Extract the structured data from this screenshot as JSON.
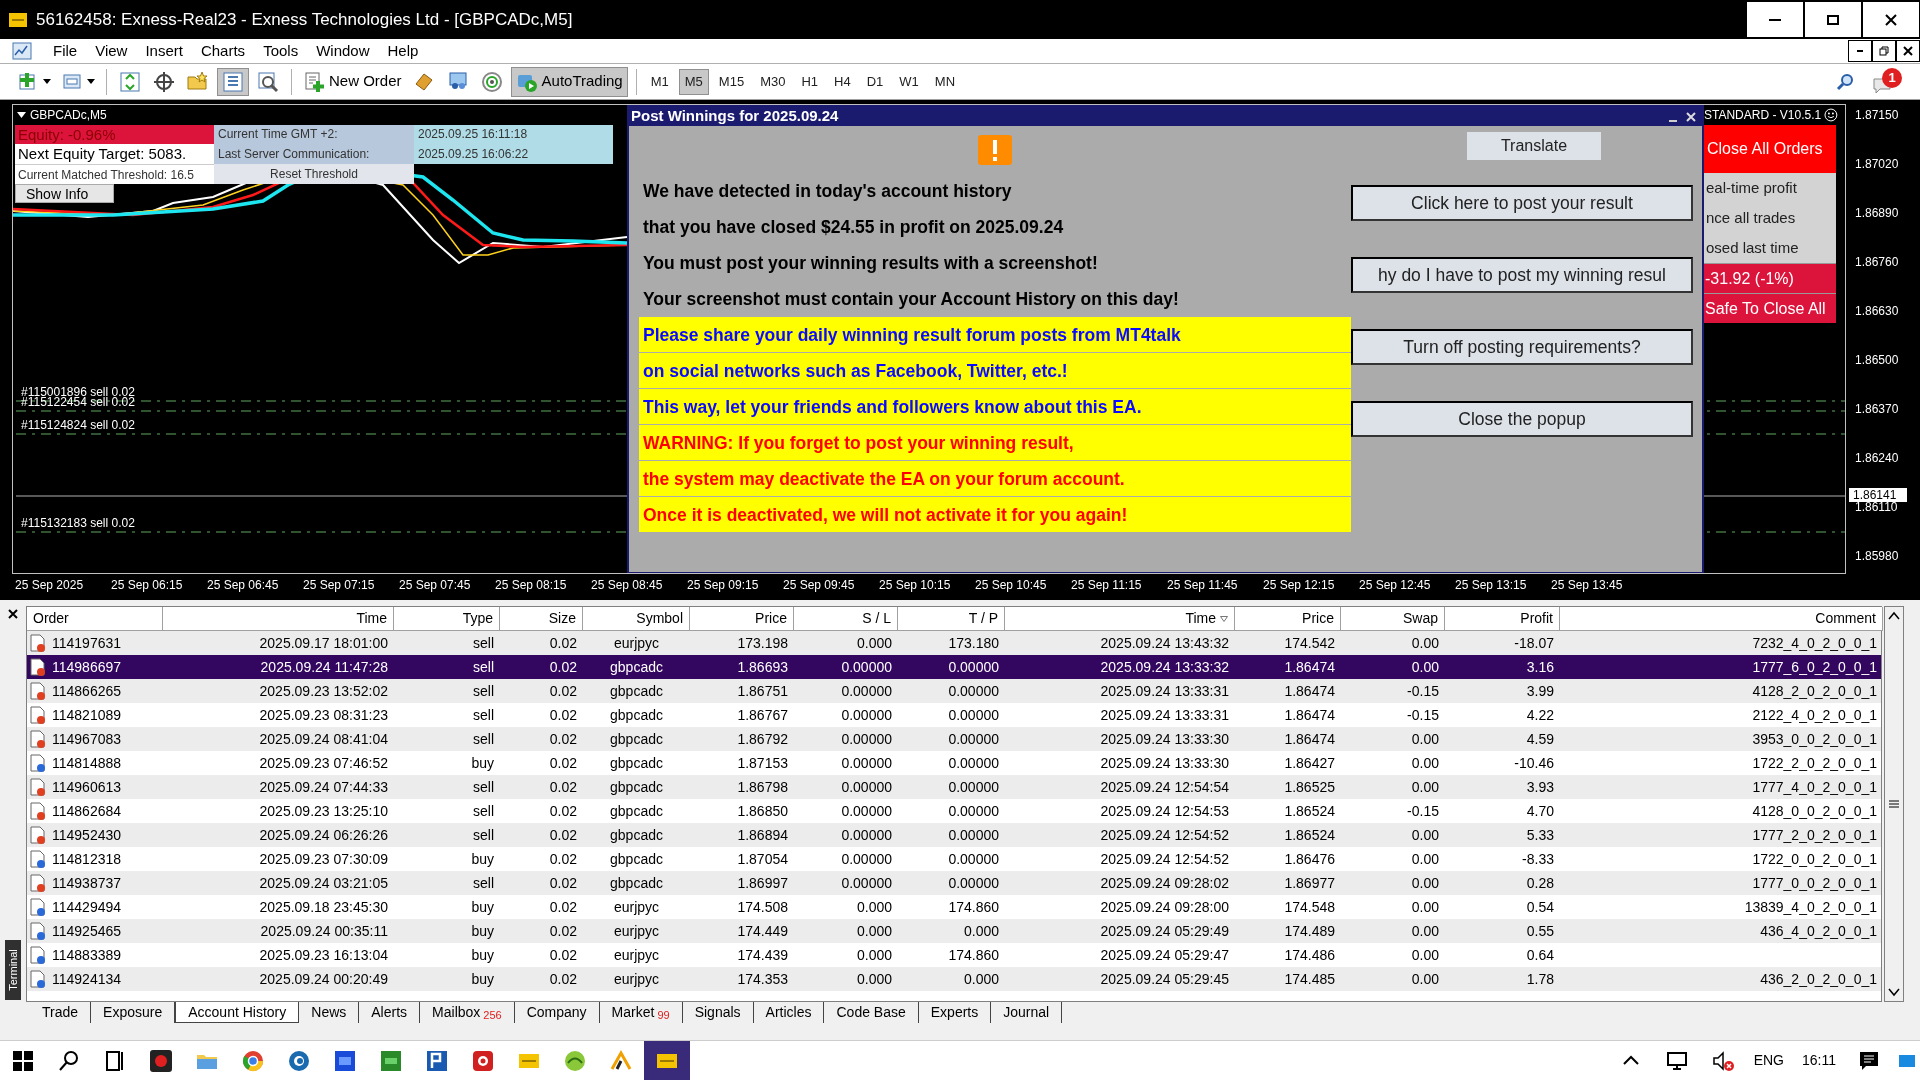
{
  "window": {
    "title": "56162458: Exness-Real23 - Exness Technologies Ltd - [GBPCADc,M5]"
  },
  "menu": [
    "File",
    "View",
    "Insert",
    "Charts",
    "Tools",
    "Window",
    "Help"
  ],
  "toolbar": {
    "new_order": "New Order",
    "autotrading": {
      "label": "AutoTrading",
      "pressed": true
    },
    "timeframes": [
      {
        "label": "M1",
        "selected": false
      },
      {
        "label": "M5",
        "selected": true
      },
      {
        "label": "M15",
        "selected": false
      },
      {
        "label": "M30",
        "selected": false
      },
      {
        "label": "H1",
        "selected": false
      },
      {
        "label": "H4",
        "selected": false
      },
      {
        "label": "D1",
        "selected": false
      },
      {
        "label": "W1",
        "selected": false
      },
      {
        "label": "MN",
        "selected": false
      }
    ],
    "notification_count": "1"
  },
  "chart": {
    "symbol": "GBPCADc,M5",
    "price_labels": [
      "1.87150",
      "1.87020",
      "1.86890",
      "1.86760",
      "1.86630",
      "1.86500",
      "1.86370",
      "1.86240",
      "1.86110",
      "1.85980"
    ],
    "current_price": "1.86141",
    "time_labels": [
      "25 Sep 2025",
      "25 Sep 06:15",
      "25 Sep 06:45",
      "25 Sep 07:15",
      "25 Sep 07:45",
      "25 Sep 08:15",
      "25 Sep 08:45",
      "25 Sep 09:15",
      "25 Sep 09:45",
      "25 Sep 10:15",
      "25 Sep 10:45",
      "25 Sep 11:15",
      "25 Sep 11:45",
      "25 Sep 12:15",
      "25 Sep 12:45",
      "25 Sep 13:15",
      "25 Sep 13:45"
    ],
    "order_lines": [
      "#115001896 sell 0.02",
      "#115122454 sell 0.02",
      "#115124824 sell 0.02",
      "#115132183 sell 0.02"
    ]
  },
  "ea_panel": {
    "equity": "Equity: -0.96%",
    "next_target": "Next Equity Target: 5083.",
    "threshold": "Current Matched Threshold: 16.5",
    "show_info": "Show Info",
    "time_label": "Current Time GMT +2:",
    "time_value": "2025.09.25 16:11:18",
    "server_label": "Last Server Communication:",
    "server_value": "2025.09.25 16:06:22",
    "reset": "Reset Threshold"
  },
  "popup": {
    "title": "Post Winnings for 2025.09.24",
    "translate": "Translate",
    "messages": [
      {
        "text": "We have detected in today's account history",
        "kind": "plain"
      },
      {
        "text": "that you have closed $24.55 in profit on 2025.09.24",
        "kind": "plain"
      },
      {
        "text": "You must post your winning results with a screenshot!",
        "kind": "plain"
      },
      {
        "text": "Your screenshot must contain your Account History on this day!",
        "kind": "plain"
      },
      {
        "text": "Please share your daily winning result forum posts from MT4talk",
        "kind": "info"
      },
      {
        "text": "on social networks such as Facebook, Twitter, etc.!",
        "kind": "info"
      },
      {
        "text": "This way, let your friends and followers know about this EA.",
        "kind": "info"
      },
      {
        "text": "WARNING: If you forget to post your winning result,",
        "kind": "warning"
      },
      {
        "text": "the system may deactivate the EA on your forum account.",
        "kind": "warning"
      },
      {
        "text": "Once it is deactivated, we will not activate it for you again!",
        "kind": "warning"
      }
    ],
    "buttons": [
      "Click here to post your result",
      "hy do I have to post my winning resul",
      "Turn off posting requirements?",
      "Close the popup"
    ]
  },
  "side_panel": {
    "version": "STANDARD - V10.5.1",
    "rows": [
      {
        "text": "Close All Orders",
        "kind": "action"
      },
      {
        "text": "eal-time profit",
        "kind": "info"
      },
      {
        "text": "nce all trades",
        "kind": "info"
      },
      {
        "text": "osed last time",
        "kind": "info"
      },
      {
        "text": "-31.92 (-1%)",
        "kind": "loss"
      },
      {
        "text": "Safe To Close All",
        "kind": "loss"
      }
    ]
  },
  "terminal": {
    "label": "Terminal",
    "columns": [
      {
        "label": "Order",
        "sorted": false
      },
      {
        "label": "Time",
        "sorted": false
      },
      {
        "label": "Type",
        "sorted": false
      },
      {
        "label": "Size",
        "sorted": false
      },
      {
        "label": "Symbol",
        "sorted": false
      },
      {
        "label": "Price",
        "sorted": false
      },
      {
        "label": "S / L",
        "sorted": false
      },
      {
        "label": "T / P",
        "sorted": false
      },
      {
        "label": "Time",
        "sorted": true
      },
      {
        "label": "Price",
        "sorted": false
      },
      {
        "label": "Swap",
        "sorted": false
      },
      {
        "label": "Profit",
        "sorted": false
      },
      {
        "label": "Comment",
        "sorted": false
      }
    ],
    "rows": [
      {
        "kind": "sell",
        "selected": false,
        "cells": [
          "114197631",
          "2025.09.17 18:01:00",
          "sell",
          "0.02",
          "eurjpyc",
          "173.198",
          "0.000",
          "173.180",
          "2025.09.24 13:43:32",
          "174.542",
          "0.00",
          "-18.07",
          "7232_4_0_2_0_0_1"
        ]
      },
      {
        "kind": "sell",
        "selected": true,
        "cells": [
          "114986697",
          "2025.09.24 11:47:28",
          "sell",
          "0.02",
          "gbpcadc",
          "1.86693",
          "0.00000",
          "0.00000",
          "2025.09.24 13:33:32",
          "1.86474",
          "0.00",
          "3.16",
          "1777_6_0_2_0_0_1"
        ]
      },
      {
        "kind": "sell",
        "selected": false,
        "cells": [
          "114866265",
          "2025.09.23 13:52:02",
          "sell",
          "0.02",
          "gbpcadc",
          "1.86751",
          "0.00000",
          "0.00000",
          "2025.09.24 13:33:31",
          "1.86474",
          "-0.15",
          "3.99",
          "4128_2_0_2_0_0_1"
        ]
      },
      {
        "kind": "sell",
        "selected": false,
        "cells": [
          "114821089",
          "2025.09.23 08:31:23",
          "sell",
          "0.02",
          "gbpcadc",
          "1.86767",
          "0.00000",
          "0.00000",
          "2025.09.24 13:33:31",
          "1.86474",
          "-0.15",
          "4.22",
          "2122_4_0_2_0_0_1"
        ]
      },
      {
        "kind": "sell",
        "selected": false,
        "cells": [
          "114967083",
          "2025.09.24 08:41:04",
          "sell",
          "0.02",
          "gbpcadc",
          "1.86792",
          "0.00000",
          "0.00000",
          "2025.09.24 13:33:30",
          "1.86474",
          "0.00",
          "4.59",
          "3953_0_0_2_0_0_1"
        ]
      },
      {
        "kind": "buy",
        "selected": false,
        "cells": [
          "114814888",
          "2025.09.23 07:46:52",
          "buy",
          "0.02",
          "gbpcadc",
          "1.87153",
          "0.00000",
          "0.00000",
          "2025.09.24 13:33:30",
          "1.86427",
          "0.00",
          "-10.46",
          "1722_2_0_2_0_0_1"
        ]
      },
      {
        "kind": "sell",
        "selected": false,
        "cells": [
          "114960613",
          "2025.09.24 07:44:33",
          "sell",
          "0.02",
          "gbpcadc",
          "1.86798",
          "0.00000",
          "0.00000",
          "2025.09.24 12:54:54",
          "1.86525",
          "0.00",
          "3.93",
          "1777_4_0_2_0_0_1"
        ]
      },
      {
        "kind": "sell",
        "selected": false,
        "cells": [
          "114862684",
          "2025.09.23 13:25:10",
          "sell",
          "0.02",
          "gbpcadc",
          "1.86850",
          "0.00000",
          "0.00000",
          "2025.09.24 12:54:53",
          "1.86524",
          "-0.15",
          "4.70",
          "4128_0_0_2_0_0_1"
        ]
      },
      {
        "kind": "sell",
        "selected": false,
        "cells": [
          "114952430",
          "2025.09.24 06:26:26",
          "sell",
          "0.02",
          "gbpcadc",
          "1.86894",
          "0.00000",
          "0.00000",
          "2025.09.24 12:54:52",
          "1.86524",
          "0.00",
          "5.33",
          "1777_2_0_2_0_0_1"
        ]
      },
      {
        "kind": "buy",
        "selected": false,
        "cells": [
          "114812318",
          "2025.09.23 07:30:09",
          "buy",
          "0.02",
          "gbpcadc",
          "1.87054",
          "0.00000",
          "0.00000",
          "2025.09.24 12:54:52",
          "1.86476",
          "0.00",
          "-8.33",
          "1722_0_0_2_0_0_1"
        ]
      },
      {
        "kind": "sell",
        "selected": false,
        "cells": [
          "114938737",
          "2025.09.24 03:21:05",
          "sell",
          "0.02",
          "gbpcadc",
          "1.86997",
          "0.00000",
          "0.00000",
          "2025.09.24 09:28:02",
          "1.86977",
          "0.00",
          "0.28",
          "1777_0_0_2_0_0_1"
        ]
      },
      {
        "kind": "buy",
        "selected": false,
        "cells": [
          "114429494",
          "2025.09.18 23:45:30",
          "buy",
          "0.02",
          "eurjpyc",
          "174.508",
          "0.000",
          "174.860",
          "2025.09.24 09:28:00",
          "174.548",
          "0.00",
          "0.54",
          "13839_4_0_2_0_0_1"
        ]
      },
      {
        "kind": "buy",
        "selected": false,
        "cells": [
          "114925465",
          "2025.09.24 00:35:11",
          "buy",
          "0.02",
          "eurjpyc",
          "174.449",
          "0.000",
          "0.000",
          "2025.09.24 05:29:49",
          "174.489",
          "0.00",
          "0.55",
          "436_4_0_2_0_0_1"
        ]
      },
      {
        "kind": "buy",
        "selected": false,
        "cells": [
          "114883389",
          "2025.09.23 16:13:04",
          "buy",
          "0.02",
          "eurjpyc",
          "174.439",
          "0.000",
          "174.860",
          "2025.09.24 05:29:47",
          "174.486",
          "0.00",
          "0.64",
          ""
        ]
      },
      {
        "kind": "buy",
        "selected": false,
        "cells": [
          "114924134",
          "2025.09.24 00:20:49",
          "buy",
          "0.02",
          "eurjpyc",
          "174.353",
          "0.000",
          "0.000",
          "2025.09.24 05:29:45",
          "174.485",
          "0.00",
          "1.78",
          "436_2_0_2_0_0_1"
        ]
      }
    ],
    "tabs": [
      {
        "label": "Trade",
        "selected": false
      },
      {
        "label": "Exposure",
        "selected": false
      },
      {
        "label": "Account History",
        "selected": true
      },
      {
        "label": "News",
        "selected": false
      },
      {
        "label": "Alerts",
        "selected": false
      },
      {
        "label": "Mailbox",
        "selected": false,
        "badge": "256"
      },
      {
        "label": "Company",
        "selected": false
      },
      {
        "label": "Market",
        "selected": false,
        "badge": "99"
      },
      {
        "label": "Signals",
        "selected": false
      },
      {
        "label": "Articles",
        "selected": false
      },
      {
        "label": "Code Base",
        "selected": false
      },
      {
        "label": "Experts",
        "selected": false
      },
      {
        "label": "Journal",
        "selected": false
      }
    ]
  },
  "taskbar": {
    "language": "ENG",
    "time": "16:11"
  }
}
